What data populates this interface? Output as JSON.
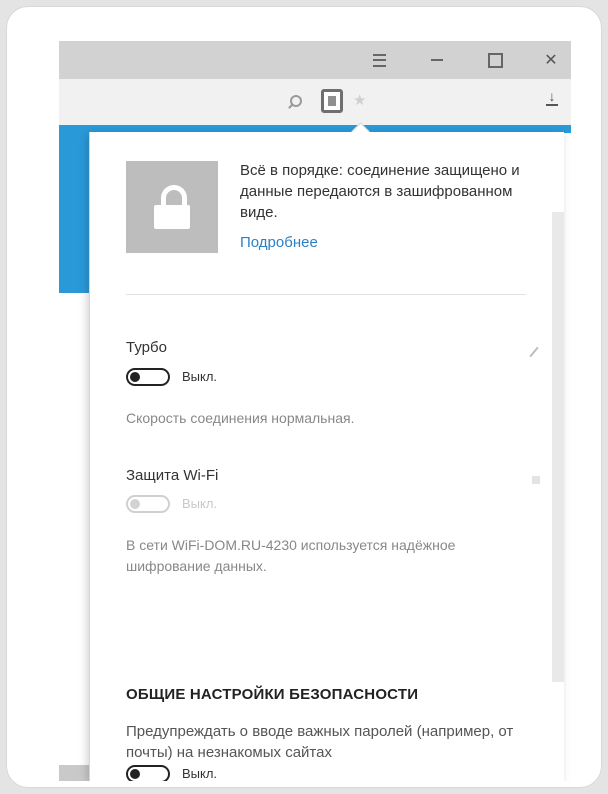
{
  "popup": {
    "secure_message": "Всё в порядке: соединение защищено и данные передаются в зашифрованном виде.",
    "more_link": "Подробнее",
    "turbo": {
      "title": "Турбо",
      "toggle_state": "Выкл.",
      "description": "Скорость соединения нормальная."
    },
    "wifi": {
      "title": "Защита Wi-Fi",
      "toggle_state": "Выкл.",
      "description": "В сети WiFi-DOM.RU-4230 используется надёжное шифрование данных."
    },
    "general": {
      "heading": "ОБЩИЕ НАСТРОЙКИ БЕЗОПАСНОСТИ",
      "warn_text": "Предупреждать о вводе важных паролей (например, от почты) на незнакомых сайтах",
      "toggle_state": "Выкл."
    }
  },
  "icons": {
    "menu": "hamburger-icon",
    "minimize": "minimize-icon",
    "maximize": "maximize-icon",
    "close": "close-icon",
    "search": "search-icon",
    "protect": "protect-icon",
    "bookmark": "bookmark-icon",
    "download": "download-icon",
    "lock": "lock-icon"
  },
  "colors": {
    "accent": "#2a99d8",
    "link": "#2a82c9"
  }
}
